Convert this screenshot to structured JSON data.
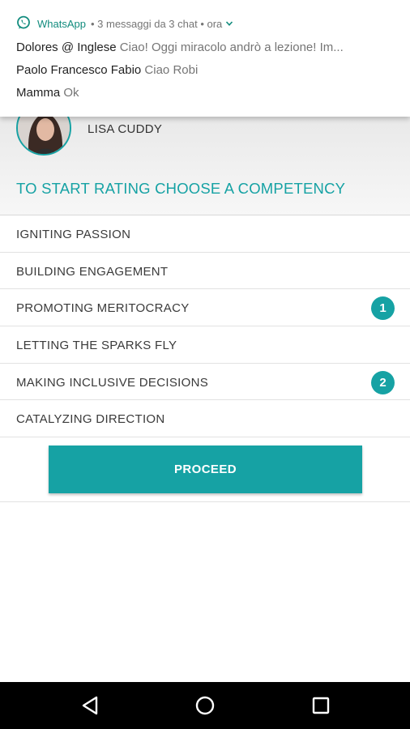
{
  "notification": {
    "app_name": "WhatsApp",
    "meta": "• 3 messaggi da 3 chat • ora",
    "rows": [
      {
        "sender": "Dolores @ Inglese",
        "message": "Ciao! Oggi miracolo andrò a lezione! Im..."
      },
      {
        "sender": "Paolo Francesco Fabio",
        "message": "Ciao Robi"
      },
      {
        "sender": "Mamma",
        "message": "Ok"
      }
    ]
  },
  "profile": {
    "name": "LISA CUDDY"
  },
  "section_title": "TO START RATING CHOOSE A COMPETENCY",
  "competencies": [
    {
      "label": "IGNITING PASSION",
      "badge": ""
    },
    {
      "label": "BUILDING ENGAGEMENT",
      "badge": ""
    },
    {
      "label": "PROMOTING MERITOCRACY",
      "badge": "1"
    },
    {
      "label": "LETTING THE SPARKS FLY",
      "badge": ""
    },
    {
      "label": "MAKING INCLUSIVE DECISIONS",
      "badge": "2"
    },
    {
      "label": "CATALYZING DIRECTION",
      "badge": ""
    }
  ],
  "proceed_label": "PROCEED",
  "icons": {
    "notification_app": "whatsapp-icon",
    "expand": "chevron-down-icon",
    "nav_back": "back-triangle-icon",
    "nav_home": "home-circle-icon",
    "nav_recents": "recents-square-icon"
  },
  "colors": {
    "accent": "#16a2a4",
    "whatsapp": "#128c7e"
  }
}
